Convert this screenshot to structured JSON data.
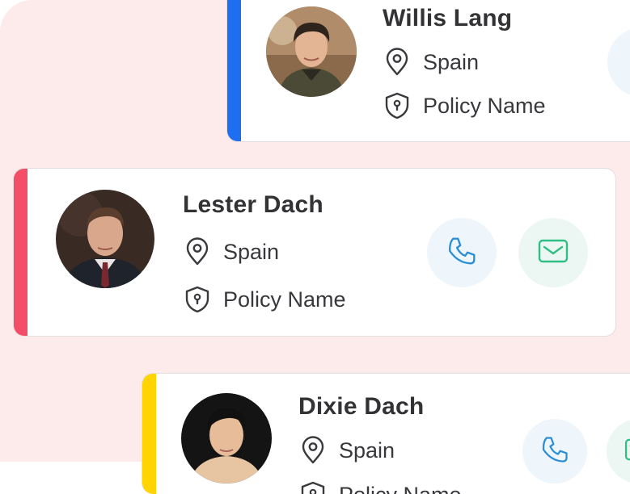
{
  "contacts": [
    {
      "name": "Willis Lang",
      "location": "Spain",
      "policy": "Policy Name",
      "accent_color": "#1e6ef0",
      "avatar_icon": "person-photo"
    },
    {
      "name": "Lester Dach",
      "location": "Spain",
      "policy": "Policy Name",
      "accent_color": "#f44d68",
      "avatar_icon": "person-photo"
    },
    {
      "name": "Dixie Dach",
      "location": "Spain",
      "policy": "Policy Name",
      "accent_color": "#ffd400",
      "avatar_icon": "person-photo"
    }
  ],
  "icons": {
    "location": "map-pin-icon",
    "policy": "shield-keyhole-icon",
    "call": "phone-icon",
    "mail": "mail-icon"
  },
  "colors": {
    "background": "#fdeaea",
    "call_icon": "#2b8fd6",
    "mail_icon": "#2fbf86"
  }
}
